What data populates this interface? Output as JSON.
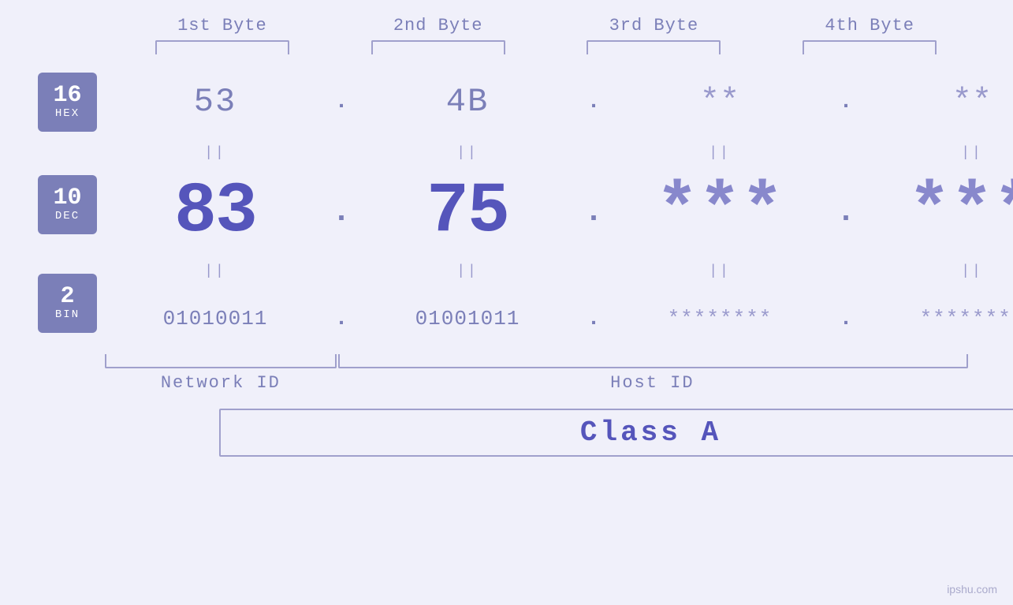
{
  "headers": {
    "byte1": "1st Byte",
    "byte2": "2nd Byte",
    "byte3": "3rd Byte",
    "byte4": "4th Byte"
  },
  "bases": {
    "hex": {
      "num": "16",
      "name": "HEX"
    },
    "dec": {
      "num": "10",
      "name": "DEC"
    },
    "bin": {
      "num": "2",
      "name": "BIN"
    }
  },
  "hex": {
    "b1": "53",
    "b2": "4B",
    "b3": "**",
    "b4": "**",
    "dot": "."
  },
  "dec": {
    "b1": "83",
    "b2": "75",
    "b3": "***",
    "b4": "***",
    "dot": "."
  },
  "bin": {
    "b1": "01010011",
    "b2": "01001011",
    "b3": "********",
    "b4": "********",
    "dot": "."
  },
  "sep": {
    "symbol": "||"
  },
  "labels": {
    "network_id": "Network ID",
    "host_id": "Host ID",
    "class": "Class A"
  },
  "watermark": "ipshu.com"
}
